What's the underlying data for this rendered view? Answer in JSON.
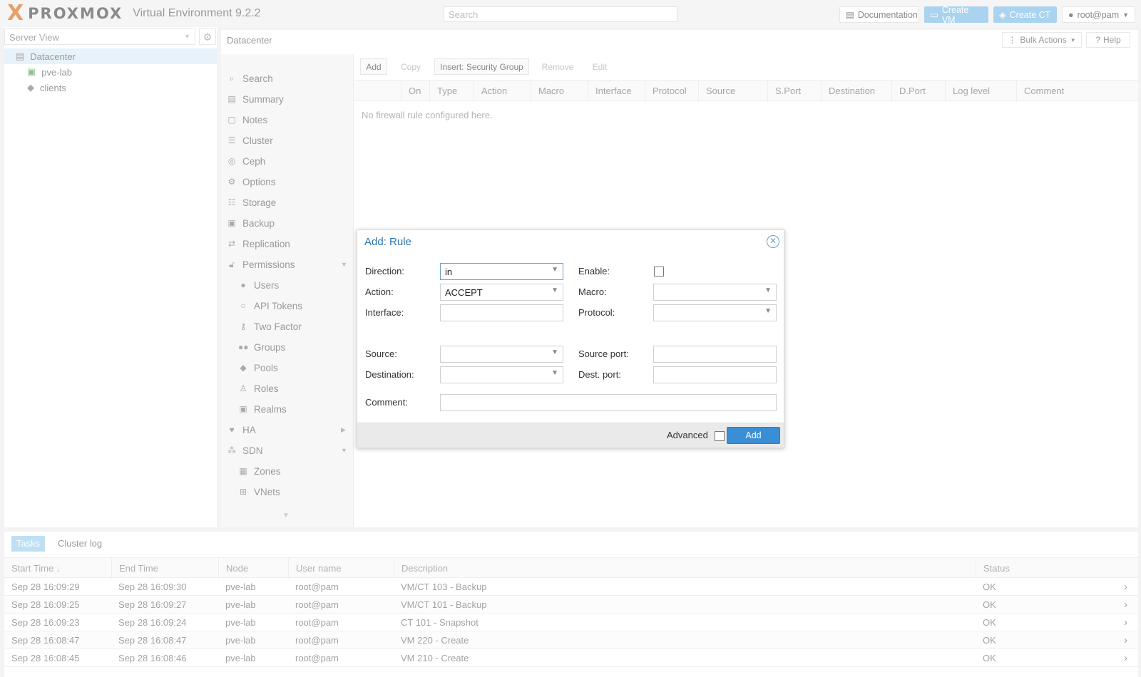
{
  "header": {
    "logo_mark": "X",
    "brand": "PROXMOX",
    "version": "Virtual Environment 9.2.2",
    "search_placeholder": "Search",
    "documentation": "Documentation",
    "create_vm": "Create VM",
    "create_ct": "Create CT",
    "user": "root@pam"
  },
  "tree": {
    "view": "Server View",
    "nodes": [
      "Datacenter",
      "pve-lab",
      "clients"
    ]
  },
  "breadcrumb": "Datacenter",
  "toolbar_right": {
    "bulk_actions": "Bulk Actions",
    "help": "Help"
  },
  "nav": {
    "items": [
      "Search",
      "Summary",
      "Notes",
      "Cluster",
      "Ceph",
      "Options",
      "Storage",
      "Backup",
      "Replication",
      "Permissions",
      "Users",
      "API Tokens",
      "Two Factor",
      "Groups",
      "Pools",
      "Roles",
      "Realms",
      "HA",
      "SDN",
      "Zones",
      "VNets"
    ]
  },
  "firewall": {
    "buttons": [
      "Add",
      "Copy",
      "Insert: Security Group",
      "Remove",
      "Edit"
    ],
    "columns": [
      "On",
      "Type",
      "Action",
      "Macro",
      "Interface",
      "Protocol",
      "Source",
      "S.Port",
      "Destination",
      "D.Port",
      "Log level",
      "Comment"
    ],
    "empty_text": "No firewall rule configured here."
  },
  "bottom": {
    "tabs": [
      "Tasks",
      "Cluster log"
    ],
    "columns": [
      "Start Time",
      "End Time",
      "Node",
      "User name",
      "Description",
      "Status"
    ],
    "rows": [
      [
        "Sep 28 16:09:29",
        "Sep 28 16:09:30",
        "pve-lab",
        "root@pam",
        "VM/CT 103 - Backup",
        "OK"
      ],
      [
        "Sep 28 16:09:25",
        "Sep 28 16:09:27",
        "pve-lab",
        "root@pam",
        "VM/CT 101 - Backup",
        "OK"
      ],
      [
        "Sep 28 16:09:23",
        "Sep 28 16:09:24",
        "pve-lab",
        "root@pam",
        "CT 101 - Snapshot",
        "OK"
      ],
      [
        "Sep 28 16:08:47",
        "Sep 28 16:08:47",
        "pve-lab",
        "root@pam",
        "VM 220 - Create",
        "OK"
      ],
      [
        "Sep 28 16:08:45",
        "Sep 28 16:08:46",
        "pve-lab",
        "root@pam",
        "VM 210 - Create",
        "OK"
      ]
    ]
  },
  "modal": {
    "title": "Add: Rule",
    "direction_label": "Direction:",
    "direction_value": "in",
    "enable_label": "Enable:",
    "action_label": "Action:",
    "action_value": "ACCEPT",
    "macro_label": "Macro:",
    "interface_label": "Interface:",
    "protocol_label": "Protocol:",
    "source_label": "Source:",
    "source_port_label": "Source port:",
    "destination_label": "Destination:",
    "dest_port_label": "Dest. port:",
    "comment_label": "Comment:",
    "advanced_label": "Advanced",
    "add_button": "Add"
  }
}
